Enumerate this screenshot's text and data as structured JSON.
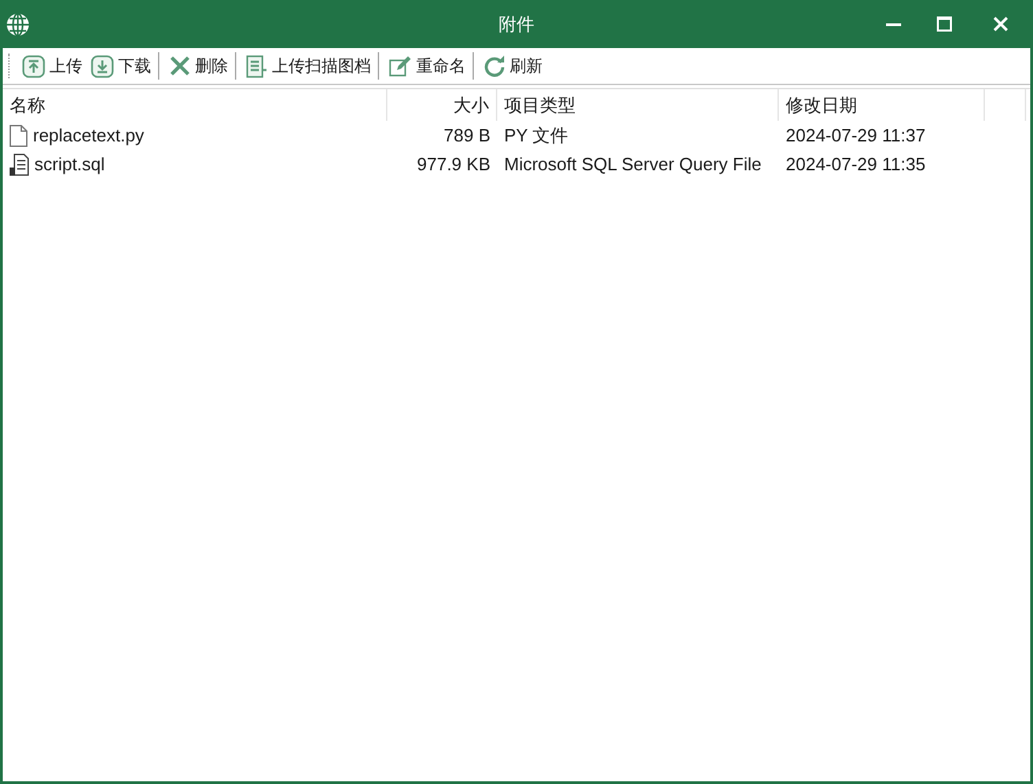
{
  "window": {
    "title": "附件"
  },
  "toolbar": [
    {
      "kind": "upload",
      "label": "上传"
    },
    {
      "kind": "download",
      "label": "下载"
    },
    {
      "kind": "delete",
      "label": "删除"
    },
    {
      "kind": "scan",
      "label": "上传扫描图档"
    },
    {
      "kind": "rename",
      "label": "重命名"
    },
    {
      "kind": "refresh",
      "label": "刷新"
    }
  ],
  "table": {
    "columns": [
      "名称",
      "大小",
      "项目类型",
      "修改日期"
    ],
    "rows": [
      {
        "kind": "text",
        "cells": [
          "replacetext.py",
          "789 B",
          "PY 文件",
          "2024-07-29 11:37"
        ]
      },
      {
        "kind": "script",
        "cells": [
          "script.sql",
          "977.9 KB",
          "Microsoft SQL Server Query File",
          "2024-07-29 11:35"
        ]
      }
    ]
  }
}
